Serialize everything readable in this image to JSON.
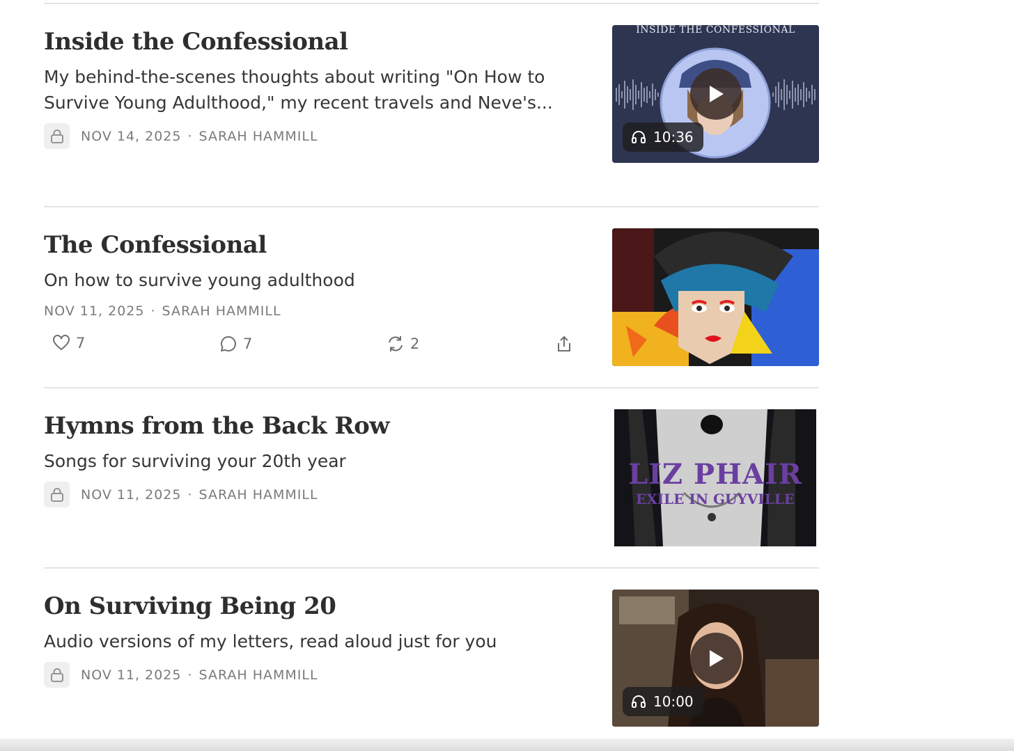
{
  "posts": [
    {
      "title": "Inside the Confessional",
      "subtitle": "My behind-the-scenes thoughts about writing \"On How to Survive Young Adulthood,\" my recent travels and Neve's...",
      "date": "NOV 14, 2025",
      "author": "SARAH HAMMILL",
      "locked": true,
      "thumbnail": {
        "overlay_text": "INSIDE THE CONFESSIONAL",
        "duration": "10:36",
        "icon": "play-icon"
      }
    },
    {
      "title": "The Confessional",
      "subtitle": "On how to survive young adulthood",
      "date": "NOV 11, 2025",
      "author": "SARAH HAMMILL",
      "locked": false,
      "actions": {
        "likes": "7",
        "comments": "7",
        "restacks": "2"
      }
    },
    {
      "title": "Hymns from the Back Row",
      "subtitle": "Songs for surviving your 20th year",
      "date": "NOV 11, 2025",
      "author": "SARAH HAMMILL",
      "locked": true,
      "thumbnail": {
        "overlay_line1": "LIZ PHAIR",
        "overlay_line2": "EXILE IN GUYVILLE"
      }
    },
    {
      "title": "On Surviving Being 20",
      "subtitle": "Audio versions of my letters, read aloud just for you",
      "date": "NOV 11, 2025",
      "author": "SARAH HAMMILL",
      "locked": true,
      "thumbnail": {
        "duration": "10:00",
        "icon": "play-icon"
      }
    }
  ],
  "separator": "·",
  "icons": {
    "lock": "lock-icon",
    "like": "heart-icon",
    "comment": "comment-icon",
    "restack": "restack-icon",
    "share": "share-icon",
    "headphones": "headphones-icon"
  },
  "colors": {
    "podcast_bg": "#2e3551",
    "audio_badge": "#1e1e1e",
    "liz_phair_purple": "#6a3fa0"
  }
}
